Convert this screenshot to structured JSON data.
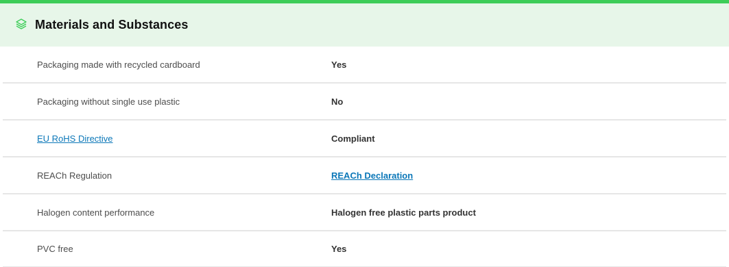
{
  "section": {
    "title": "Materials and Substances",
    "icon": "layers-icon",
    "accent_color": "#3dcd58",
    "header_bg": "#e7f6e9",
    "link_color": "#0b77b8"
  },
  "rows": [
    {
      "label": "Packaging made with recycled cardboard",
      "value": "Yes"
    },
    {
      "label": "Packaging without single use plastic",
      "value": "No"
    },
    {
      "label": "EU RoHS Directive",
      "value": "Compliant"
    },
    {
      "label": "REACh Regulation",
      "value": "REACh Declaration"
    },
    {
      "label": "Halogen content performance",
      "value": "Halogen free plastic parts product"
    },
    {
      "label": "PVC free",
      "value": "Yes"
    }
  ]
}
